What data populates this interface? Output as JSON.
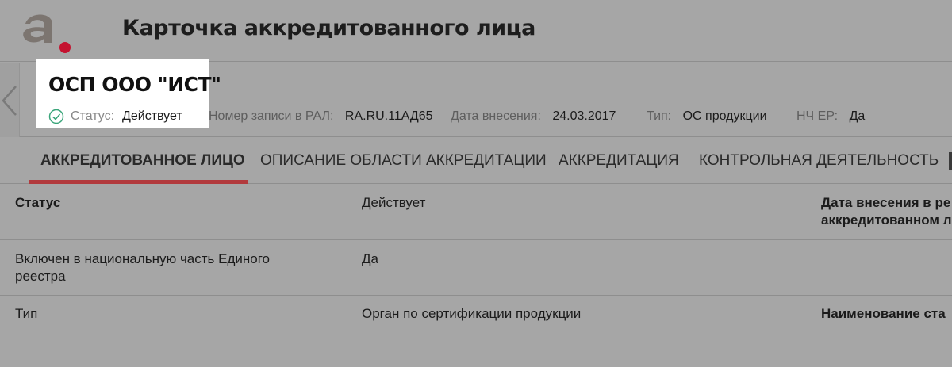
{
  "header": {
    "title": "Карточка аккредитованного лица",
    "logo_icon": "brand-logo-a"
  },
  "org": {
    "name": "ОСП ООО \"ИСТ\"",
    "status_label": "Статус:",
    "status_value": "Действует",
    "status_icon": "check-circle-icon"
  },
  "meta": {
    "reg_label": "Номер записи в РАЛ:",
    "reg_value": "RA.RU.11АД65",
    "date_label": "Дата внесения:",
    "date_value": "24.03.2017",
    "type_label": "Тип:",
    "type_value": "ОС продукции",
    "nch_label": "НЧ ЕР:",
    "nch_value": "Да"
  },
  "tabs": [
    {
      "label": "АККРЕДИТОВАННОЕ ЛИЦО",
      "active": true
    },
    {
      "label": "ОПИСАНИЕ ОБЛАСТИ АККРЕДИТАЦИИ",
      "active": false
    },
    {
      "label": "АККРЕДИТАЦИЯ",
      "active": false
    },
    {
      "label": "КОНТРОЛЬНАЯ ДЕЯТЕЛЬНОСТЬ",
      "active": false
    }
  ],
  "table": {
    "rows": [
      {
        "label": "Статус",
        "value": "Действует",
        "right_label_line1": "Дата внесения в ре",
        "right_label_line2": "аккредитованном л"
      },
      {
        "label_line1": "Включен в национальную часть Единого",
        "label_line2": "реестра",
        "value": "Да"
      },
      {
        "label": "Тип",
        "value": "Орган по сертификации продукции",
        "right_label": "Наименование ста"
      }
    ]
  },
  "colors": {
    "accent": "#b23a3d",
    "status_ok": "#3aa57a",
    "background": "#a6a6a6"
  }
}
